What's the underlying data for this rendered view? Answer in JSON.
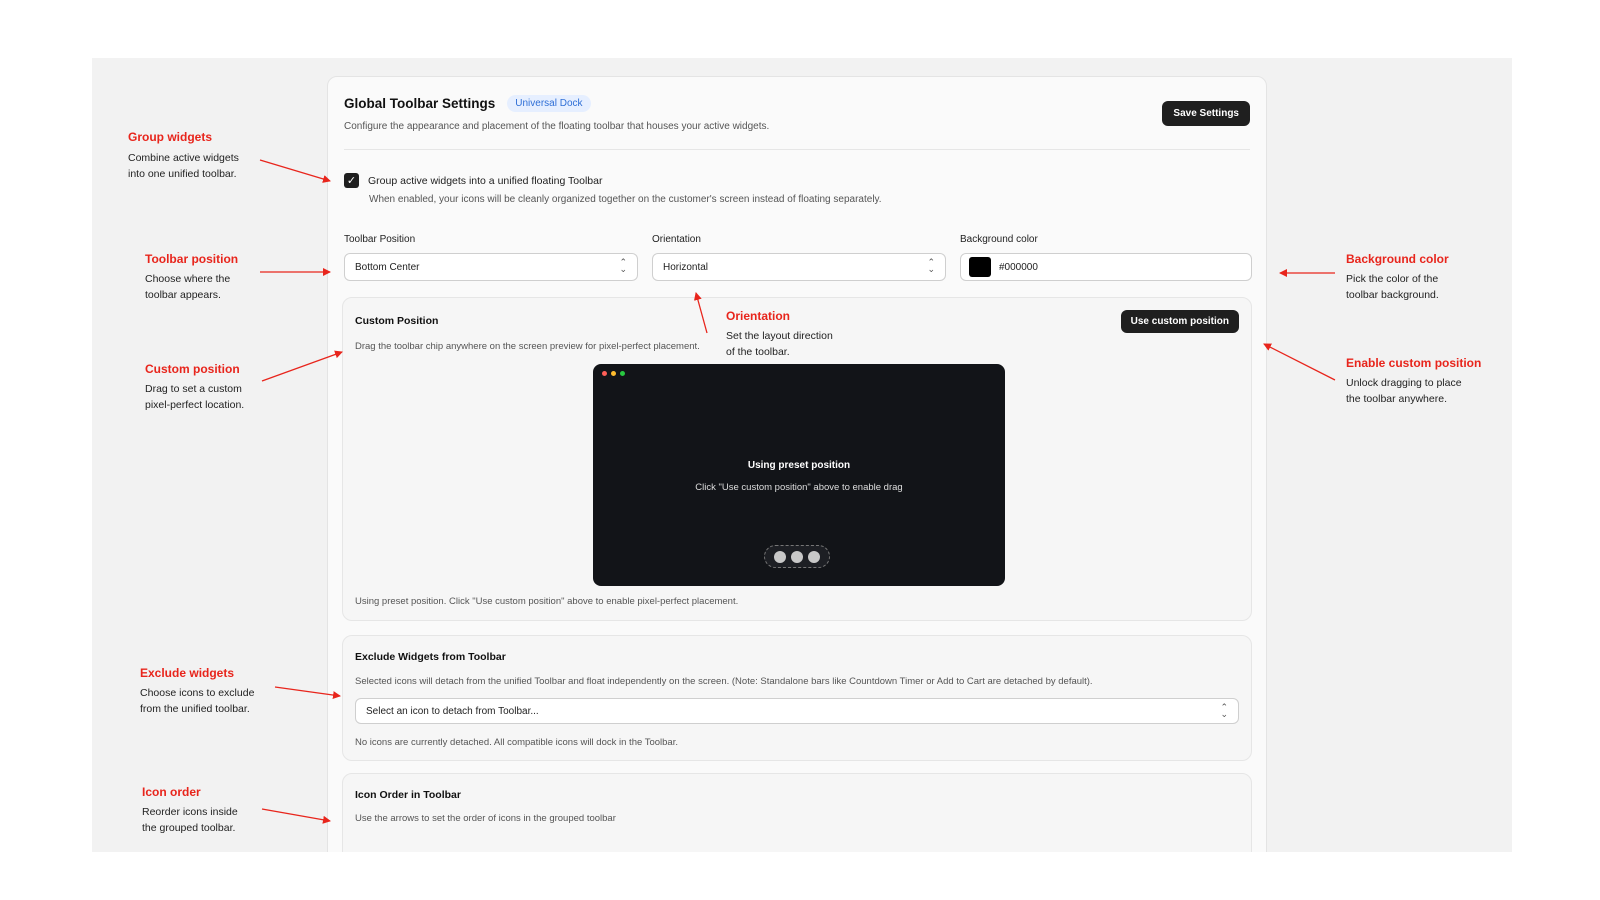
{
  "header": {
    "title": "Global Toolbar Settings",
    "badge": "Universal Dock",
    "subtitle": "Configure the appearance and placement of the floating toolbar that houses your active widgets.",
    "save_label": "Save Settings"
  },
  "group": {
    "checked": true,
    "check_glyph": "✓",
    "label": "Group active widgets into a unified floating Toolbar",
    "help": "When enabled, your icons will be cleanly organized together on the customer's screen instead of floating separately."
  },
  "fields": {
    "position_label": "Toolbar Position",
    "position_value": "Bottom Center",
    "orientation_label": "Orientation",
    "orientation_value": "Horizontal",
    "bg_label": "Background color",
    "bg_value": "#000000"
  },
  "custom_position": {
    "title": "Custom Position",
    "desc": "Drag the toolbar chip anywhere on the screen preview for pixel-perfect placement.",
    "button": "Use custom position",
    "preview_title": "Using preset position",
    "preview_sub": "Click \"Use custom position\" above to enable drag",
    "footer": "Using preset position. Click \"Use custom position\" above to enable pixel-perfect placement."
  },
  "exclude": {
    "title": "Exclude Widgets from Toolbar",
    "desc": "Selected icons will detach from the unified Toolbar and float independently on the screen. (Note: Standalone bars like Countdown Timer or Add to Cart are detached by default).",
    "placeholder": "Select an icon to detach from Toolbar...",
    "status": "No icons are currently detached. All compatible icons will dock in the Toolbar."
  },
  "icon_order": {
    "title": "Icon Order in Toolbar",
    "desc": "Use the arrows to set the order of icons in the grouped toolbar"
  },
  "annotations": {
    "group": {
      "title": "Group widgets",
      "line1": "Combine active widgets",
      "line2": "into one unified toolbar."
    },
    "position": {
      "title": "Toolbar position",
      "line1": "Choose where the",
      "line2": "toolbar appears."
    },
    "custom": {
      "title": "Custom position",
      "line1": "Drag to set a custom",
      "line2": "pixel-perfect location."
    },
    "exclude": {
      "title": "Exclude widgets",
      "line1": "Choose icons to exclude",
      "line2": "from the unified toolbar."
    },
    "order": {
      "title": "Icon order",
      "line1": "Reorder icons inside",
      "line2": "the grouped toolbar."
    },
    "orientation": {
      "title": "Orientation",
      "line1": "Set the layout direction",
      "line2": "of the toolbar."
    },
    "bg": {
      "title": "Background color",
      "line1": "Pick the color of the",
      "line2": "toolbar background."
    },
    "enable": {
      "title": "Enable custom position",
      "line1": "Unlock dragging to place",
      "line2": "the toolbar anywhere."
    }
  },
  "colors": {
    "annotation_red": "#e8251c",
    "dark": "#1f1f1f",
    "badge_text": "#2f6fd6",
    "badge_bg": "#e6efff",
    "dot_red": "#ff5f57",
    "dot_yellow": "#febc2e",
    "dot_green": "#28c840"
  },
  "icons": {
    "checkbox": "check-icon",
    "select": "chevron-up-down-icon",
    "preview_dots": "window-controls-icon",
    "chip": "toolbar-chip-icon"
  }
}
